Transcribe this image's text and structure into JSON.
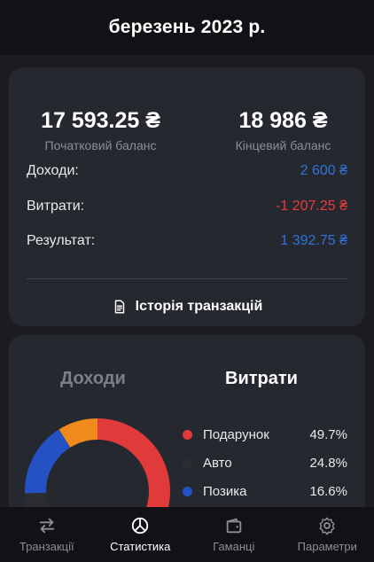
{
  "header": {
    "title": "березень 2023 р."
  },
  "balance": {
    "start_value": "17 593.25 ₴",
    "start_label": "Початковий баланс",
    "end_value": "18 986 ₴",
    "end_label": "Кінцевий баланс"
  },
  "summary": {
    "income_label": "Доходи:",
    "income_value": "2 600 ₴",
    "expense_label": "Витрати:",
    "expense_value": "-1 207.25 ₴",
    "result_label": "Результат:",
    "result_value": "1 392.75 ₴"
  },
  "history_button": {
    "label": "Історія транзакцій",
    "icon": "document-icon"
  },
  "stats": {
    "income_tab": "Доходи",
    "expense_tab": "Витрати",
    "legend": [
      {
        "name": "Подарунок",
        "pct": "49.7%",
        "color": "#e03a3a"
      },
      {
        "name": "Авто",
        "pct": "24.8%",
        "color": "#2b2d33"
      },
      {
        "name": "Позика",
        "pct": "16.6%",
        "color": "#2451c4"
      }
    ]
  },
  "nav": [
    {
      "label": "Транзакції",
      "icon": "swap-arrows-icon",
      "active": false
    },
    {
      "label": "Статистика",
      "icon": "pie-chart-icon",
      "active": true
    },
    {
      "label": "Гаманці",
      "icon": "wallet-icon",
      "active": false
    },
    {
      "label": "Параметри",
      "icon": "gear-icon",
      "active": false
    }
  ],
  "colors": {
    "accent_blue": "#2f73d9",
    "accent_red": "#e83c3c",
    "donut_orange": "#f08a1c"
  }
}
